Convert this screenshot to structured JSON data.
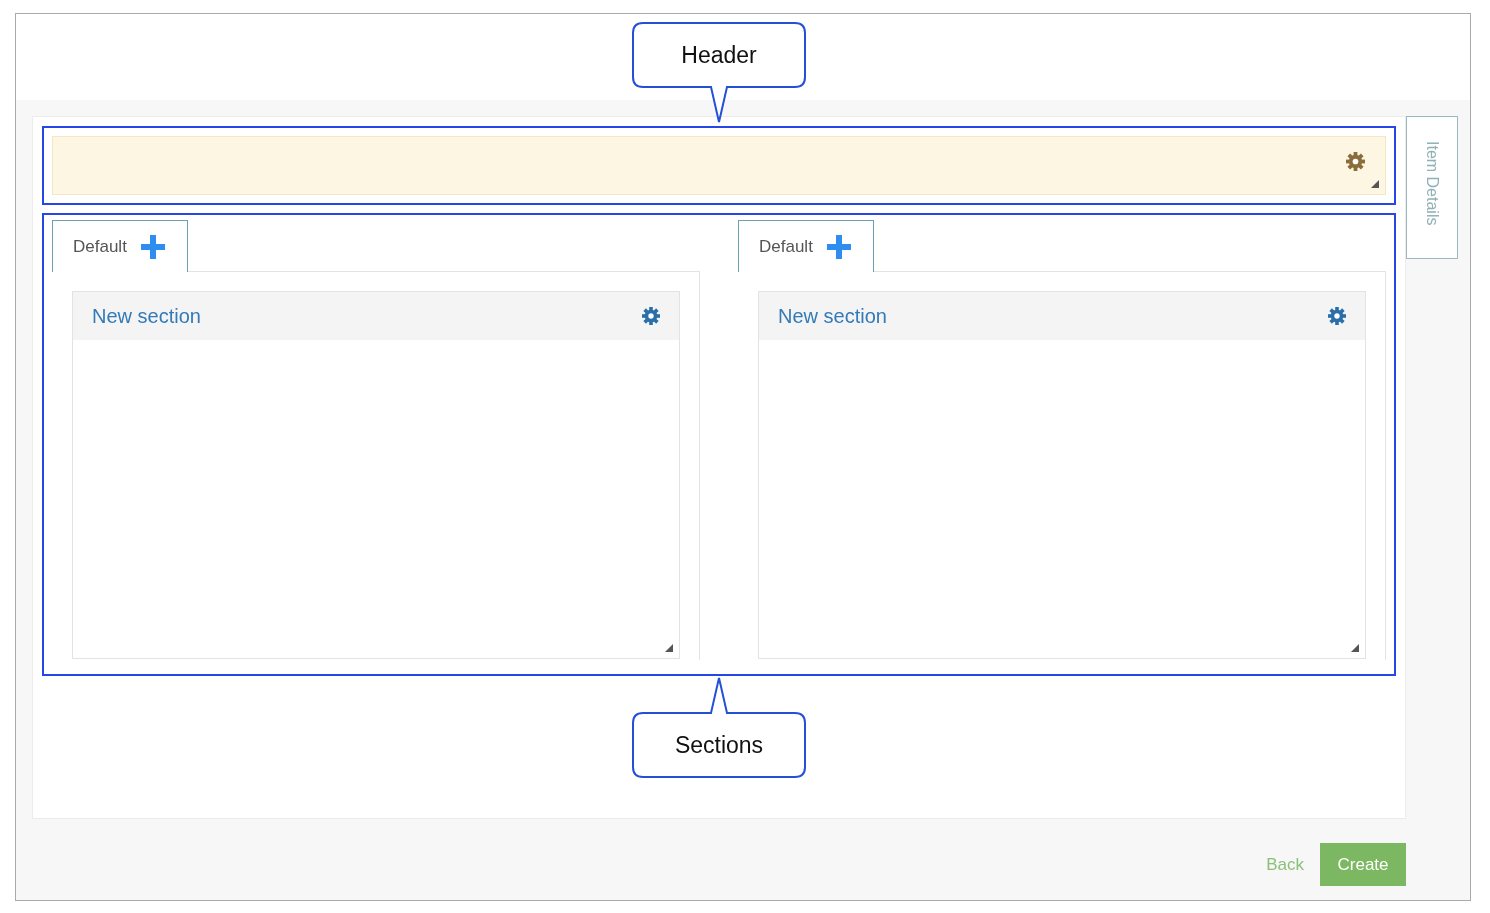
{
  "columns": [
    {
      "tab": {
        "label": "Default",
        "selected": true
      },
      "section": {
        "title": "New section"
      }
    },
    {
      "tab": {
        "label": "Default",
        "selected": true
      },
      "section": {
        "title": "New section"
      }
    }
  ],
  "side_tab": {
    "label": "Item Details"
  },
  "buttons": {
    "back": "Back",
    "create": "Create"
  },
  "callouts": {
    "header": {
      "label": "Header"
    },
    "sections": {
      "label": "Sections"
    }
  }
}
